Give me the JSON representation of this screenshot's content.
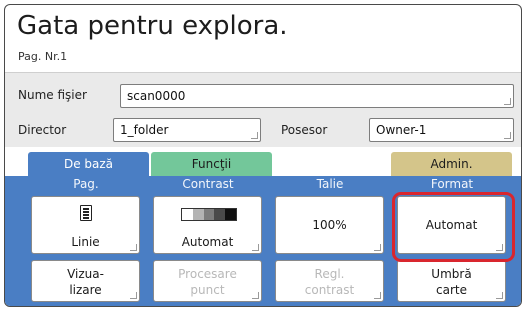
{
  "header": {
    "title": "Gata pentru explora.",
    "page_number": "Pag. Nr.1"
  },
  "fields": {
    "file_name_label": "Nume fişier",
    "file_name_value": "scan0000",
    "directory_label": "Director",
    "directory_value": "1_folder",
    "owner_label": "Posesor",
    "owner_value": "Owner-1"
  },
  "tabs": {
    "basic": "De bază",
    "functions": "Funcţii",
    "admin": "Admin."
  },
  "columns": {
    "page": "Pag.",
    "contrast": "Contrast",
    "size": "Talie",
    "format": "Format"
  },
  "settings": {
    "page_value": "Linie",
    "contrast_value": "Automat",
    "size_value": "100%",
    "format_value": "Automat"
  },
  "actions": {
    "preview": "Vizua-\nlizare",
    "dot_processing": "Procesare\npunct",
    "contrast_adjust": "Regl.\ncontrast",
    "book_shadow": "Umbră\ncarte"
  },
  "colors": {
    "accent_blue": "#4a7ec4",
    "functions_green": "#73c79a",
    "admin_gold": "#d4c58a",
    "highlight_red": "#d9262e"
  },
  "icons": {
    "page": "document-icon",
    "contrast": "contrast-scale-icon"
  }
}
